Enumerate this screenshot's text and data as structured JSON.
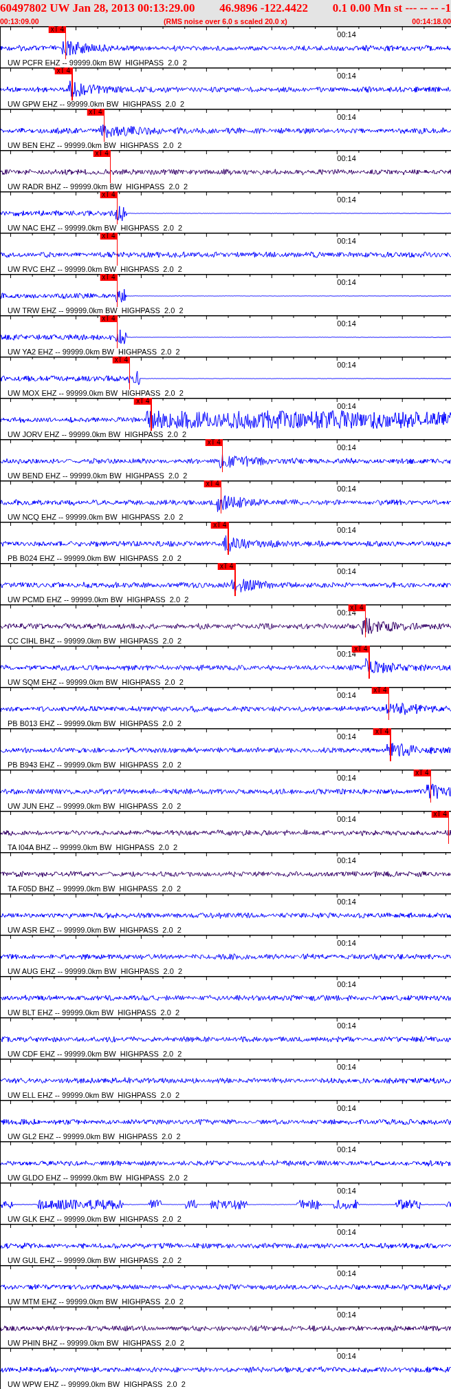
{
  "header": {
    "event": [
      "60497802 UW Jan 28, 2013 00:13:29.00",
      "46.9896 -122.4422",
      "0.1 0.00 Mn st --- -- --  -1"
    ],
    "start_time": "00:13:09.00",
    "caption": "(RMS noise over 6.0 s scaled 20.0 x)",
    "end_time": "00:14:18.00"
  },
  "traces": [
    {
      "label": "UW PCFR EHZ -- 99999.0km BW  HIGHPASS  2.0  2",
      "time_label": "00:14",
      "color": "#0000ff",
      "kind": "event",
      "pick": {
        "label": "xT 4",
        "level": 0.145
      }
    },
    {
      "label": "UW GPW EHZ -- 99999.0km BW  HIGHPASS  2.0  2",
      "time_label": "00:14",
      "color": "#0000ff",
      "kind": "event",
      "pick": {
        "label": "xT 4",
        "level": 0.159
      }
    },
    {
      "label": "UW BEN EHZ -- 99999.0km BW  HIGHPASS  2.0  2",
      "time_label": "00:14",
      "color": "#0000ff",
      "kind": "event",
      "pick": {
        "label": "xT 4",
        "level": 0.23
      }
    },
    {
      "label": "UW RADR BHZ -- 99999.0km BW  HIGHPASS  2.0  2",
      "time_label": "00:14",
      "color": "#330066",
      "kind": "noise",
      "pick": {
        "label": "xT 4",
        "level": 0.244
      }
    },
    {
      "label": "UW NAC EHZ -- 99999.0km BW  HIGHPASS  2.0  2",
      "time_label": "00:14",
      "color": "#0000ff",
      "kind": "dead",
      "pick": {
        "label": "xT 4",
        "level": 0.259
      }
    },
    {
      "label": "UW RVC EHZ -- 99999.0km BW  HIGHPASS  2.0  2",
      "time_label": "00:14",
      "color": "#0000ff",
      "kind": "noise",
      "pick": {
        "label": "xT 4",
        "level": 0.259
      }
    },
    {
      "label": "UW TRW EHZ -- 99999.0km BW  HIGHPASS  2.0  2",
      "time_label": "00:14",
      "color": "#0000ff",
      "kind": "dead",
      "pick": {
        "label": "xT 4",
        "level": 0.259
      }
    },
    {
      "label": "UW YA2 EHZ -- 99999.0km BW  HIGHPASS  2.0  2",
      "time_label": "00:14",
      "color": "#0000ff",
      "kind": "dead",
      "pick": {
        "label": "xT 4",
        "level": 0.259
      }
    },
    {
      "label": "UW MOX EHZ -- 99999.0km BW  HIGHPASS  2.0  2",
      "time_label": "00:14",
      "color": "#0000ff",
      "kind": "dead",
      "pick": {
        "label": "xT 4",
        "level": 0.287
      }
    },
    {
      "label": "UW JORV EHZ -- 99999.0km BW  HIGHPASS  2.0  2",
      "time_label": "00:14",
      "color": "#0000ff",
      "kind": "saturated",
      "pick": {
        "label": "xT 4",
        "level": 0.335
      }
    },
    {
      "label": "UW BEND EHZ -- 99999.0km BW  HIGHPASS  2.0  2",
      "time_label": "00:14",
      "color": "#0000ff",
      "kind": "event",
      "pick": {
        "label": "xT 4",
        "level": 0.493
      }
    },
    {
      "label": "UW NCQ EHZ -- 99999.0km BW  HIGHPASS  2.0  2",
      "time_label": "00:14",
      "color": "#0000ff",
      "kind": "event",
      "pick": {
        "label": "xT 4",
        "level": 0.49
      }
    },
    {
      "label": "PB B024 EHZ -- 99999.0km BW  HIGHPASS  2.0  2",
      "time_label": "00:14",
      "color": "#0000ff",
      "kind": "event",
      "pick": {
        "label": "xT 4",
        "level": 0.506
      }
    },
    {
      "label": "UW PCMD EHZ -- 99999.0km BW  HIGHPASS  2.0  2",
      "time_label": "00:14",
      "color": "#0000ff",
      "kind": "event",
      "pick": {
        "label": "xT 4",
        "level": 0.521
      }
    },
    {
      "label": "CC CIHL BHZ -- 99999.0km BW  HIGHPASS  2.0  2",
      "time_label": "00:14",
      "color": "#330066",
      "kind": "event",
      "pick": {
        "label": "xT 4",
        "level": 0.81
      }
    },
    {
      "label": "UW SQM EHZ -- 99999.0km BW  HIGHPASS  2.0  2",
      "time_label": "00:14",
      "color": "#0000ff",
      "kind": "event",
      "pick": {
        "label": "xT 4",
        "level": 0.819
      }
    },
    {
      "label": "PB B013 EHZ -- 99999.0km BW  HIGHPASS  2.0  2",
      "time_label": "00:14",
      "color": "#0000ff",
      "kind": "event",
      "pick": {
        "label": "xT 4",
        "level": 0.862
      }
    },
    {
      "label": "PB B943 EHZ -- 99999.0km BW  HIGHPASS  2.0  2",
      "time_label": "00:14",
      "color": "#0000ff",
      "kind": "event",
      "pick": {
        "label": "xT 4",
        "level": 0.866
      }
    },
    {
      "label": "UW JUN EHZ -- 99999.0km BW  HIGHPASS  2.0  2",
      "time_label": "00:14",
      "color": "#0000ff",
      "kind": "event",
      "pick": {
        "label": "xT 4",
        "level": 0.955
      }
    },
    {
      "label": "TA I04A BHZ -- 99999.0km BW  HIGHPASS  2.0  2",
      "time_label": "00:14",
      "color": "#330066",
      "kind": "noise",
      "pick": {
        "label": "xT 4",
        "level": 0.995
      }
    },
    {
      "label": "TA F05D BHZ -- 99999.0km BW  HIGHPASS  2.0  2",
      "time_label": "00:14",
      "color": "#330066",
      "kind": "noise"
    },
    {
      "label": "UW ASR EHZ -- 99999.0km BW  HIGHPASS  2.0  2",
      "time_label": "00:14",
      "color": "#0000ff",
      "kind": "noise"
    },
    {
      "label": "UW AUG EHZ -- 99999.0km BW  HIGHPASS  2.0  2",
      "time_label": "00:14",
      "color": "#0000ff",
      "kind": "noise"
    },
    {
      "label": "UW BLT EHZ -- 99999.0km BW  HIGHPASS  2.0  2",
      "time_label": "00:14",
      "color": "#0000ff",
      "kind": "noise"
    },
    {
      "label": "UW CDF EHZ -- 99999.0km BW  HIGHPASS  2.0  2",
      "time_label": "00:14",
      "color": "#0000ff",
      "kind": "noise"
    },
    {
      "label": "UW ELL EHZ -- 99999.0km BW  HIGHPASS  2.0  2",
      "time_label": "00:14",
      "color": "#0000ff",
      "kind": "noise"
    },
    {
      "label": "UW GL2 EHZ -- 99999.0km BW  HIGHPASS  2.0  2",
      "time_label": "00:14",
      "color": "#0000ff",
      "kind": "noise"
    },
    {
      "label": "UW GLDO EHZ -- 99999.0km BW  HIGHPASS  2.0  2",
      "time_label": "00:14",
      "color": "#0000ff",
      "kind": "noise"
    },
    {
      "label": "UW GLK EHZ -- 99999.0km BW  HIGHPASS  2.0  2",
      "time_label": "00:14",
      "color": "#0000ff",
      "kind": "gappy"
    },
    {
      "label": "UW GUL EHZ -- 99999.0km BW  HIGHPASS  2.0  2",
      "time_label": "00:14",
      "color": "#0000ff",
      "kind": "noise"
    },
    {
      "label": "UW MTM EHZ -- 99999.0km BW  HIGHPASS  2.0  2",
      "time_label": "00:14",
      "color": "#0000ff",
      "kind": "noise"
    },
    {
      "label": "UW PHIN BHZ -- 99999.0km BW  HIGHPASS  2.0  2",
      "time_label": "00:14",
      "color": "#330066",
      "kind": "noise"
    },
    {
      "label": "UW WPW EHZ -- 99999.0km BW  HIGHPASS  2.0  2",
      "time_label": "00:14",
      "color": "#0000ff",
      "kind": "noise"
    }
  ]
}
